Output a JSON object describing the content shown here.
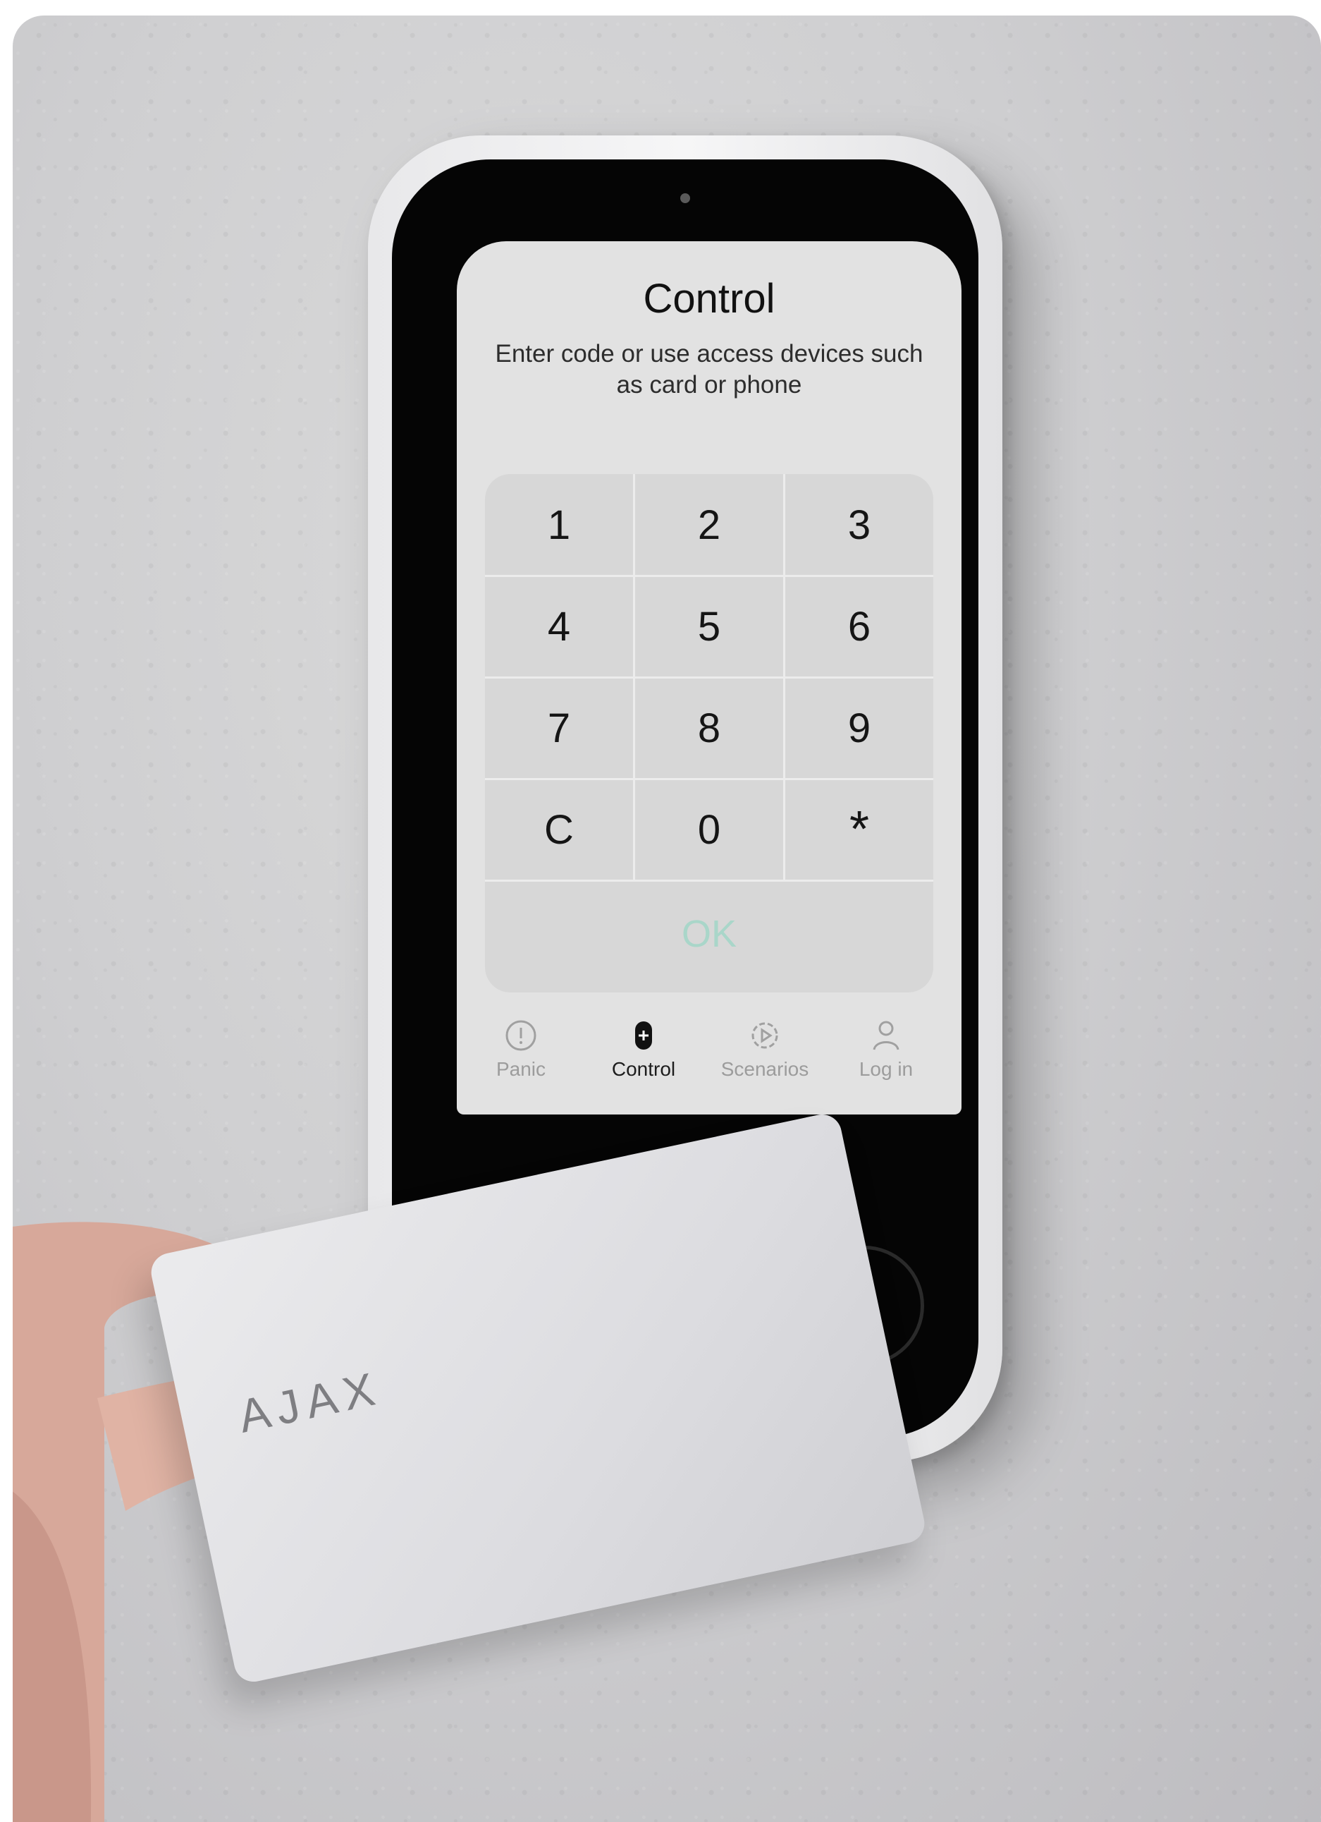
{
  "screen": {
    "title": "Control",
    "subtitle": "Enter code or use access devices such as card or phone"
  },
  "keypad": {
    "keys": [
      "1",
      "2",
      "3",
      "4",
      "5",
      "6",
      "7",
      "8",
      "9",
      "C",
      "0",
      "*"
    ],
    "ok_label": "OK",
    "ok_color": "#a9d6c9"
  },
  "nav": {
    "items": [
      {
        "label": "Panic",
        "icon": "panic-icon"
      },
      {
        "label": "Control",
        "icon": "control-icon"
      },
      {
        "label": "Scenarios",
        "icon": "scenarios-icon"
      },
      {
        "label": "Log in",
        "icon": "user-icon"
      }
    ],
    "active": "Control"
  },
  "card": {
    "logo": "AJAX"
  }
}
